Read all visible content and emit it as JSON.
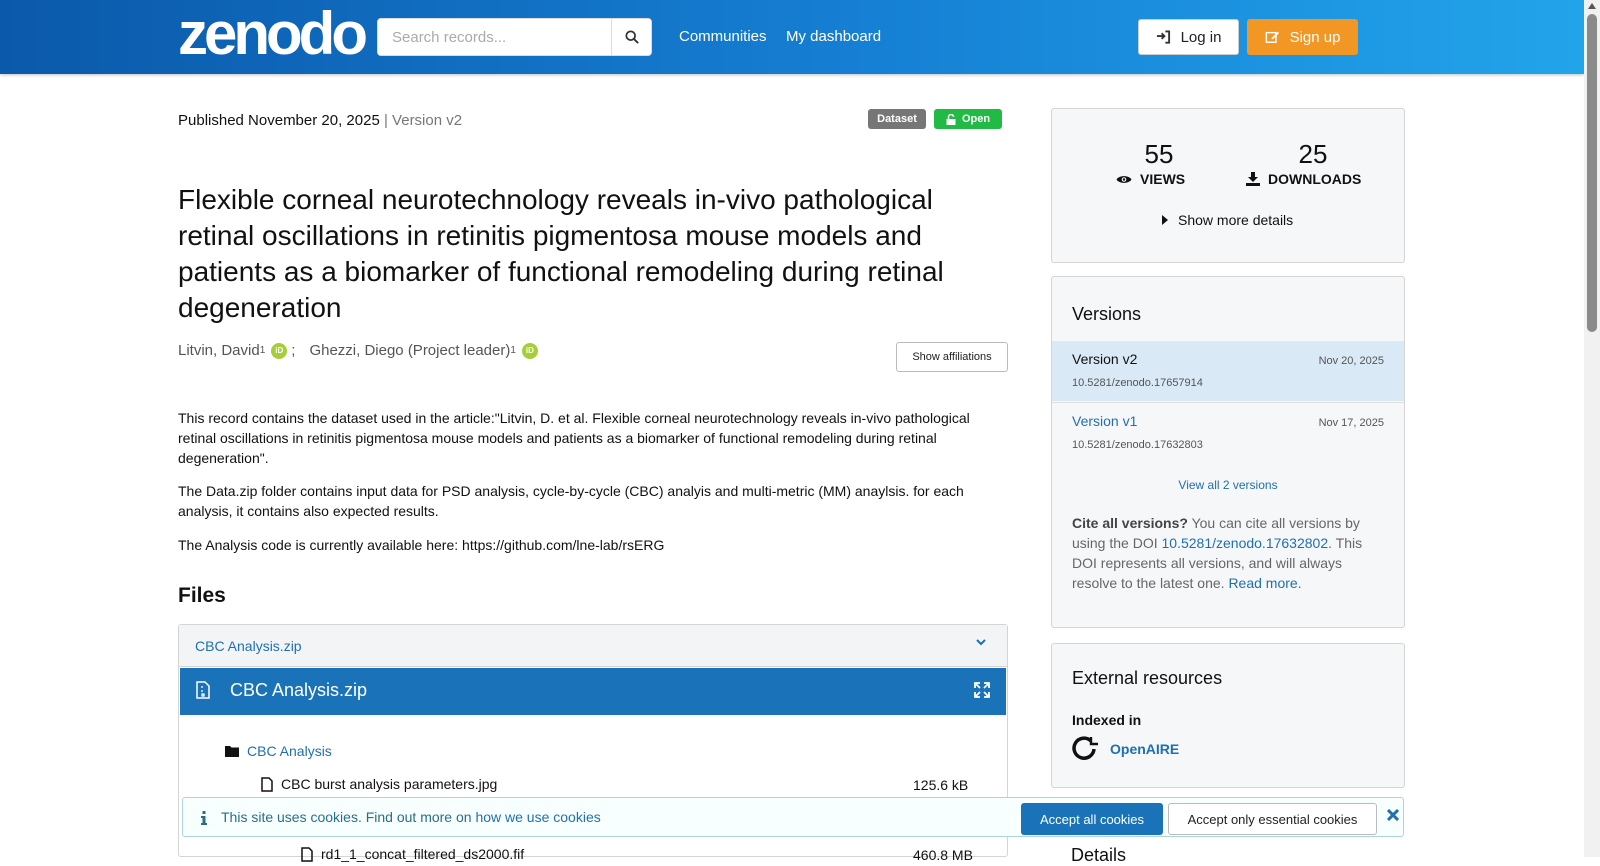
{
  "header": {
    "logo": "zenodo",
    "search_placeholder": "Search records...",
    "nav": [
      "Communities",
      "My dashboard"
    ],
    "login_label": "Log in",
    "signup_label": "Sign up"
  },
  "record": {
    "published": "Published November 20, 2025",
    "version": "Version v2",
    "badge_type": "Dataset",
    "badge_access": "Open",
    "title": "Flexible corneal neurotechnology reveals in-vivo pathological retinal oscillations in retinitis pigmentosa mouse models and patients as a biomarker of functional remodeling during retinal degeneration",
    "creators": [
      {
        "name": "Litvin, David",
        "aff": "1",
        "sep": ";"
      },
      {
        "name": "Ghezzi, Diego (Project leader)",
        "aff": "1",
        "sep": ""
      }
    ],
    "show_affiliations": "Show affiliations",
    "description": [
      "This record contains the dataset used in the article:\"Litvin, D. et al. Flexible corneal neurotechnology reveals in-vivo pathological retinal oscillations in retinitis pigmentosa mouse models and patients as a biomarker of functional remodeling during retinal degeneration\".",
      "The Data.zip folder contains input data for PSD analysis, cycle-by-cycle (CBC) analyis and multi-metric (MM) anaylsis. for each analysis, it contains also expected results.",
      "The Analysis code is currently available here: https://github.com/lne-lab/rsERG"
    ]
  },
  "files": {
    "heading": "Files",
    "accordion_label": "CBC Analysis.zip",
    "preview_title": "CBC Analysis.zip",
    "folder": "CBC Analysis",
    "items": [
      {
        "name": "CBC burst analysis parameters.jpg",
        "size": "125.6 kB"
      },
      {
        "name": "rd1_1_concat_filtered_ds2000.fif",
        "size": "460.8 MB"
      }
    ]
  },
  "stats": {
    "views": "55",
    "views_label": "VIEWS",
    "downloads": "25",
    "downloads_label": "DOWNLOADS",
    "show_more": "Show more details"
  },
  "versions": {
    "heading": "Versions",
    "items": [
      {
        "name": "Version v2",
        "date": "Nov 20, 2025",
        "doi": "10.5281/zenodo.17657914"
      },
      {
        "name": "Version v1",
        "date": "Nov 17, 2025",
        "doi": "10.5281/zenodo.17632803"
      }
    ],
    "view_all": "View all 2 versions",
    "cite_bold": "Cite all versions?",
    "cite_text1": " You can cite all versions by using the DOI ",
    "cite_doi": "10.5281/zenodo.17632802",
    "cite_text2": ". This DOI represents all versions, and will always resolve to the latest one. ",
    "read_more": "Read more",
    "cite_end": "."
  },
  "external": {
    "heading": "External resources",
    "indexed_in": "Indexed in",
    "openaire": "OpenAIRE"
  },
  "details_heading": "Details",
  "cookie": {
    "text": "This site uses cookies. Find out more on ",
    "link": "how we use cookies",
    "accept_all": "Accept all cookies",
    "accept_essential": "Accept only essential cookies"
  },
  "colors": {
    "accent": "#1a73b8",
    "signup": "#f29624",
    "open_badge": "#21ba45",
    "orcid": "#a6ce39"
  }
}
